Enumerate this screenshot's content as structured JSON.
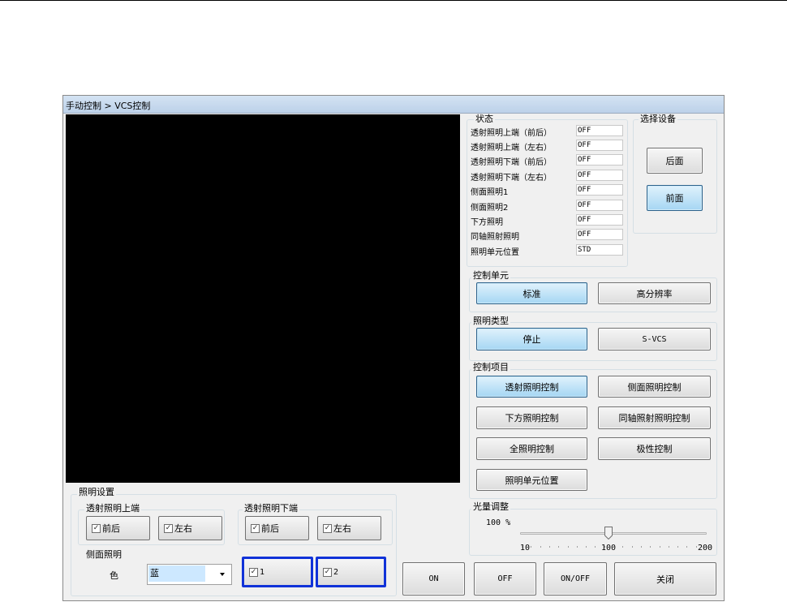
{
  "window": {
    "title": "手动控制 > VCS控制"
  },
  "status": {
    "group_label": "状态",
    "rows": [
      {
        "label": "透射照明上端（前后）",
        "value": "OFF"
      },
      {
        "label": "透射照明上端（左右）",
        "value": "OFF"
      },
      {
        "label": "透射照明下端（前后）",
        "value": "OFF"
      },
      {
        "label": "透射照明下端（左右）",
        "value": "OFF"
      },
      {
        "label": "侧面照明1",
        "value": "OFF"
      },
      {
        "label": "侧面照明2",
        "value": "OFF"
      },
      {
        "label": "下方照明",
        "value": "OFF"
      },
      {
        "label": "同轴照射照明",
        "value": "OFF"
      },
      {
        "label": "照明单元位置",
        "value": "STD"
      }
    ]
  },
  "device": {
    "group_label": "选择设备",
    "back": "后面",
    "front": "前面",
    "selected": "前面"
  },
  "control_unit": {
    "group_label": "控制单元",
    "standard": "标准",
    "high_res": "高分辨率",
    "selected": "标准"
  },
  "lighting_type": {
    "group_label": "照明类型",
    "stop": "停止",
    "svcs": "S-VCS",
    "selected": "停止"
  },
  "control_items": {
    "group_label": "控制项目",
    "transmit": "透射照明控制",
    "side": "侧面照明控制",
    "bottom": "下方照明控制",
    "coaxial": "同轴照射照明控制",
    "all": "全照明控制",
    "polarity": "极性控制",
    "unit_position": "照明单元位置",
    "selected": "透射照明控制"
  },
  "light_adjust": {
    "group_label": "光量调整",
    "value_text": "100 %",
    "value": 100,
    "min_label": "10",
    "mid_label": "100",
    "max_label": "200"
  },
  "light_settings": {
    "group_label": "照明设置",
    "upper": {
      "label": "透射照明上端",
      "front_back": "前后",
      "left_right": "左右",
      "front_back_checked": true,
      "left_right_checked": true
    },
    "lower": {
      "label": "透射照明下端",
      "front_back": "前后",
      "left_right": "左右",
      "front_back_checked": true,
      "left_right_checked": true
    },
    "side": {
      "label": "侧面照明",
      "color_label": "色",
      "color_value": "蓝",
      "opt1": "1",
      "opt2": "2",
      "opt1_checked": true,
      "opt2_checked": true
    },
    "check_mark": "✓"
  },
  "actions": {
    "on": "ON",
    "off": "OFF",
    "onoff": "ON/OFF",
    "close": "关闭"
  }
}
